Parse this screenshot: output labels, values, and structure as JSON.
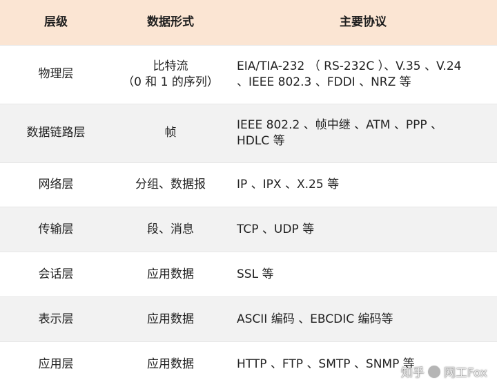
{
  "table": {
    "headers": [
      "层级",
      "数据形式",
      "主要协议"
    ],
    "rows": [
      {
        "layer": "物理层",
        "data_form": "比特流\n（0 和 1 的序列）",
        "protocols": "EIA/TIA-232 （ RS-232C ）、V.35 、V.24\n、IEEE 802.3 、FDDI 、NRZ 等"
      },
      {
        "layer": "数据链路层",
        "data_form": "帧",
        "protocols": "IEEE 802.2 、帧中继 、ATM 、PPP 、\nHDLC 等"
      },
      {
        "layer": "网络层",
        "data_form": "分组、数据报",
        "protocols": "IP 、IPX 、X.25 等"
      },
      {
        "layer": "传输层",
        "data_form": "段、消息",
        "protocols": "TCP 、UDP 等"
      },
      {
        "layer": "会话层",
        "data_form": "应用数据",
        "protocols": "SSL 等"
      },
      {
        "layer": "表示层",
        "data_form": "应用数据",
        "protocols": "ASCII 编码 、EBCDIC 编码等"
      },
      {
        "layer": "应用层",
        "data_form": "应用数据",
        "protocols": "HTTP 、FTP 、SMTP 、SNMP 等"
      }
    ]
  },
  "watermark": {
    "left": "知乎",
    "right": "网工Fox"
  },
  "colors": {
    "header_bg": "#fbe5d3",
    "stripe_bg": "#f2f2f2",
    "text": "#222222"
  }
}
